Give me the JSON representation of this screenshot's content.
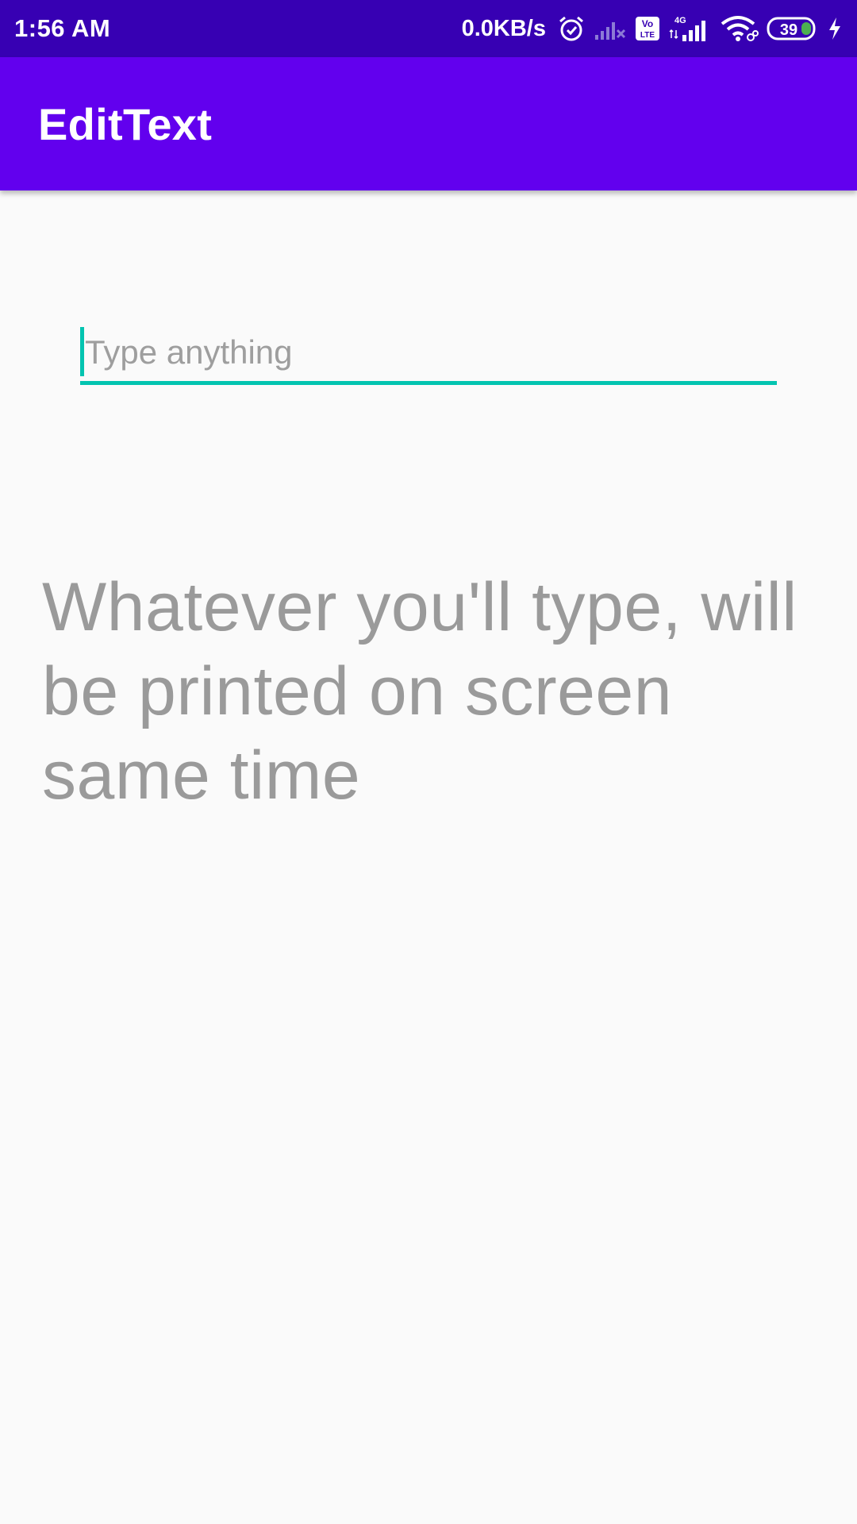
{
  "status_bar": {
    "time": "1:56 AM",
    "net_speed": "0.0KB/s",
    "volte_badge_top": "Vo",
    "volte_badge_bottom": "LTE",
    "network_type": "4G",
    "battery_level": "39",
    "icons": [
      "alarm-icon",
      "signal-no-sim-icon",
      "volte-icon",
      "signal-4g-icon",
      "wifi-icon",
      "battery-icon",
      "charging-icon"
    ]
  },
  "app_bar": {
    "title": "EditText"
  },
  "edit_text": {
    "value": "",
    "placeholder": "Type anything"
  },
  "output": {
    "text": "Whatever you'll type, will be printed on screen same time"
  },
  "colors": {
    "status_bar": "#3700b3",
    "app_bar": "#6200ee",
    "accent": "#03dac5",
    "background": "#fafafa",
    "output_text": "#9a9a9a"
  }
}
